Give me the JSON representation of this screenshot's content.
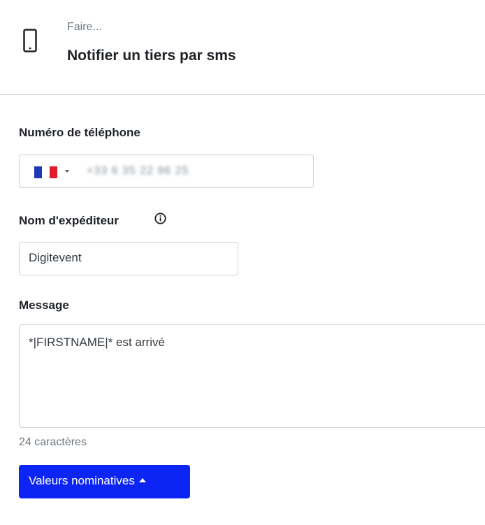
{
  "header": {
    "icon": "smartphone-icon",
    "pre_title": "Faire...",
    "title": "Notifier un tiers par sms"
  },
  "phone": {
    "label": "Numéro de téléphone",
    "country": "FR",
    "flag_colors": [
      "#1d3ab4",
      "#ffffff",
      "#e21c2b"
    ],
    "value": "+33 6 35 22 96 25"
  },
  "sender": {
    "label": "Nom d'expéditeur",
    "info_icon": "info-circle-icon",
    "value": "Digitevent"
  },
  "message": {
    "label": "Message",
    "value": "*|FIRSTNAME|* est arrivé",
    "char_count": "24 caractères"
  },
  "actions": {
    "nominative_values_label": "Valeurs nominatives",
    "accent": "#0d25f4"
  }
}
